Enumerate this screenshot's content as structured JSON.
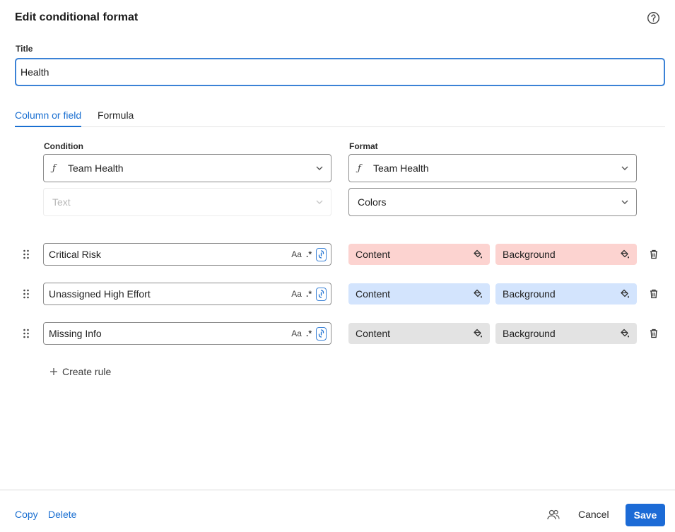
{
  "dialog": {
    "title": "Edit conditional format"
  },
  "title_field": {
    "label": "Title",
    "value": "Health"
  },
  "tabs": [
    {
      "label": "Column or field",
      "active": true
    },
    {
      "label": "Formula",
      "active": false
    }
  ],
  "condition": {
    "label": "Condition",
    "field_select": "Team Health",
    "type_select_placeholder": "Text"
  },
  "format": {
    "label": "Format",
    "field_select": "Team Health",
    "mode_select": "Colors"
  },
  "rules": [
    {
      "value": "Critical Risk",
      "content_label": "Content",
      "background_label": "Background",
      "content_color": "#fcd3d0",
      "background_color": "#fcd3d0"
    },
    {
      "value": "Unassigned High Effort",
      "content_label": "Content",
      "background_label": "Background",
      "content_color": "#d3e4fd",
      "background_color": "#d3e4fd"
    },
    {
      "value": "Missing Info",
      "content_label": "Content",
      "background_label": "Background",
      "content_color": "#e3e3e3",
      "background_color": "#e3e3e3"
    }
  ],
  "rule_options": {
    "match_case": "Aa",
    "regex": ".*"
  },
  "create_rule": {
    "label": "Create rule"
  },
  "footer": {
    "copy_label": "Copy",
    "delete_label": "Delete",
    "cancel_label": "Cancel",
    "save_label": "Save"
  },
  "colors": {
    "accent": "#1a6fd1",
    "save_bg": "#1c6bd6"
  }
}
